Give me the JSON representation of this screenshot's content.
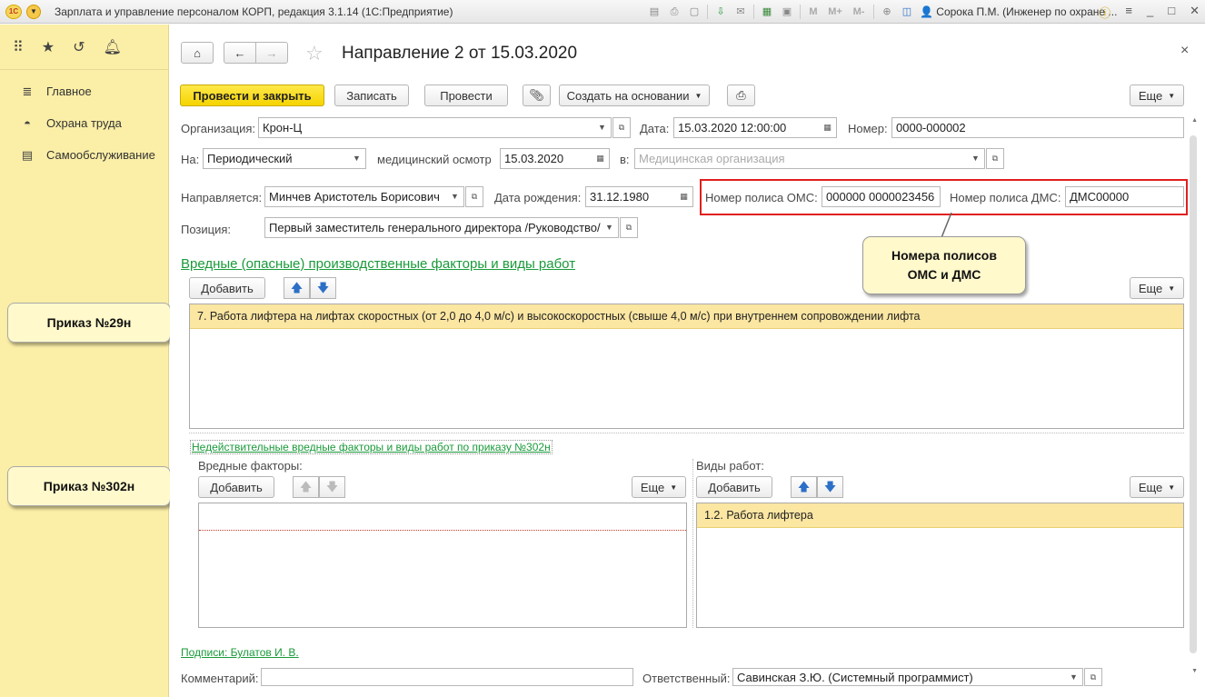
{
  "window": {
    "title": "Зарплата и управление персоналом КОРП, редакция 3.1.14 (1С:Предприятие)",
    "user": "Сорока П.М. (Инженер по охране ...",
    "toolbar_icons": [
      "save-icon",
      "print-icon",
      "preview-icon",
      "download-icon",
      "email-icon",
      "calculator-icon",
      "calendar-icon",
      "memory-icon",
      "memory-plus-icon",
      "memory-minus-icon",
      "zoom-icon",
      "window-icon",
      "user-icon",
      "info-icon",
      "menu-icon",
      "minimize-icon",
      "maximize-icon",
      "close-icon"
    ],
    "memory_labels": [
      "M",
      "M+",
      "M-"
    ]
  },
  "sidebar": {
    "items": [
      {
        "label": "Главное",
        "icon": "menu-lines-icon"
      },
      {
        "label": "Охрана труда",
        "icon": "helmet-icon"
      },
      {
        "label": "Самообслуживание",
        "icon": "id-card-icon"
      }
    ],
    "callout_29": "Приказ №29н",
    "callout_302": "Приказ №302н"
  },
  "form": {
    "title": "Направление 2 от 15.03.2020",
    "close": "×",
    "buttons": {
      "post_close": "Провести и закрыть",
      "save": "Записать",
      "post": "Провести",
      "create_based": "Создать на основании",
      "more": "Еще"
    },
    "org_label": "Организация:",
    "org_value": "Крон-Ц",
    "date_label": "Дата:",
    "date_value": "15.03.2020 12:00:00",
    "number_label": "Номер:",
    "number_value": "0000-000002",
    "to_label": "На:",
    "to_value": "Периодический",
    "medical_label": "медицинский осмотр",
    "medical_date": "15.03.2020",
    "in_label": "в:",
    "med_org_placeholder": "Медицинская организация",
    "sent_label": "Направляется:",
    "sent_value": "Минчев Аристотель Борисович",
    "birth_label": "Дата рождения:",
    "birth_value": "31.12.1980",
    "oms_label": "Номер полиса ОМС:",
    "oms_value": "000000 0000023456",
    "dms_label": "Номер полиса ДМС:",
    "dms_value": "ДМС00000",
    "position_label": "Позиция:",
    "position_value": "Первый заместитель генерального директора /Руководство/",
    "callout_policies": [
      "Номера полисов",
      "ОМС и ДМС"
    ],
    "harmful_link": "Вредные (опасные) производственные факторы и виды работ",
    "add": "Добавить",
    "harmful_rows": [
      "7. Работа лифтера на лифтах скоростных (от 2,0 до 4,0 м/с) и высокоскоростных (свыше 4,0 м/с) при внутреннем сопровождении лифта"
    ],
    "invalid_link": "Недействительные вредные факторы и виды работ по приказу №302н",
    "factors_label": "Вредные факторы:",
    "works_label": "Виды работ:",
    "works_rows": [
      "1.2. Работа лифтера"
    ],
    "signatures_link": "Подписи: Булатов И. В.",
    "comment_label": "Комментарий:",
    "responsible_label": "Ответственный:",
    "responsible_value": "Савинская З.Ю. (Системный программист)"
  }
}
